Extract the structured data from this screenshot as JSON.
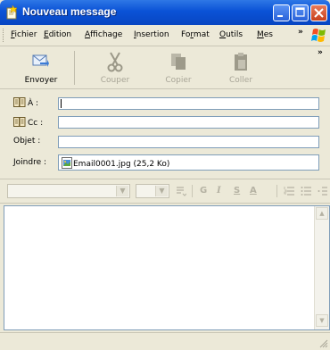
{
  "window": {
    "title": "Nouveau message"
  },
  "menubar": {
    "items": [
      {
        "label": "Fichier",
        "accel": "F",
        "rest": "ichier"
      },
      {
        "label": "Edition",
        "accel": "E",
        "rest": "dition"
      },
      {
        "label": "Affichage",
        "accel": "A",
        "rest": "ffichage"
      },
      {
        "label": "Insertion",
        "accel": "I",
        "rest": "nsertion"
      },
      {
        "label": "Format",
        "pre": "Fo",
        "accel": "r",
        "rest": "mat"
      },
      {
        "label": "Outils",
        "accel": "O",
        "rest": "utils"
      },
      {
        "label": "Mes",
        "accel": "M",
        "rest": "es"
      }
    ],
    "more": "»"
  },
  "toolbar": {
    "send": "Envoyer",
    "cut": "Couper",
    "copy": "Copier",
    "paste": "Coller",
    "more": "»"
  },
  "fields": {
    "to_label": "À :",
    "cc_label": "Cc :",
    "subject_label": "Objet :",
    "attach_label": "Joindre :",
    "attachment": "Email0001.jpg (25,2 Ko)"
  },
  "formatbar": {
    "bold": "G",
    "italic": "I",
    "underline": "S",
    "fontcolor": "A"
  },
  "colors": {
    "title_bar": "#0a52d6",
    "chrome": "#ece9d8",
    "input_border": "#7f9db9"
  }
}
